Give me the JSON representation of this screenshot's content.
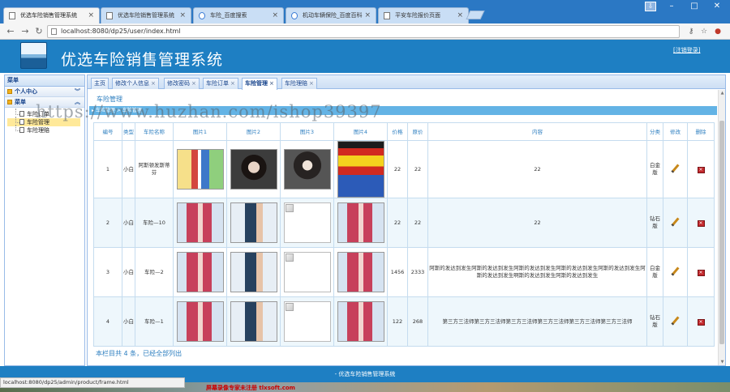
{
  "browser": {
    "tabs": [
      {
        "title": "优选车险销售管理系统"
      },
      {
        "title": "优选车险销售管理系统"
      },
      {
        "title": "车险_百度搜索"
      },
      {
        "title": "机动车辆保险_百度百科"
      },
      {
        "title": "平安车险报价页面"
      }
    ],
    "url": "localhost:8080/dp25/user/index.html",
    "status_url": "localhost:8080/dp25/admin/product/frame.html"
  },
  "app": {
    "title": "优选车险销售管理系统",
    "top_link": "[注销登录]",
    "footer": "- 优选车险销售管理系统"
  },
  "menu": {
    "header": "菜单",
    "sections": [
      {
        "label": "个人中心",
        "items": []
      },
      {
        "label": "菜单",
        "items": [
          {
            "label": "车险订单",
            "selected": false
          },
          {
            "label": "车险管理",
            "selected": true
          },
          {
            "label": "车险理赔",
            "selected": false
          }
        ]
      }
    ]
  },
  "content_tabs": [
    {
      "label": "主页",
      "active": false,
      "closable": false
    },
    {
      "label": "修改个人信息",
      "active": false,
      "closable": true
    },
    {
      "label": "修改密码",
      "active": false,
      "closable": true
    },
    {
      "label": "车险订单",
      "active": false,
      "closable": true
    },
    {
      "label": "车险管理",
      "active": true,
      "closable": true
    },
    {
      "label": "车险理赔",
      "active": false,
      "closable": true
    }
  ],
  "page": {
    "section_title": "车险管理",
    "bar_text": "▸ 车险管理 > 车险管理",
    "summary": "本栏目共 4 条，已经全部列出"
  },
  "table": {
    "headers": [
      "编号",
      "类型",
      "车险名称",
      "图片1",
      "图片2",
      "图片3",
      "图片4",
      "价格",
      "原价",
      "内容",
      "分类",
      "修改",
      "删除"
    ],
    "rows": [
      {
        "id": "1",
        "type": "小白",
        "name": "阿斯顿发斯蒂芬",
        "img1": "cartoon",
        "img2": "dark",
        "img3": "gray",
        "img4": "lego",
        "price": "22",
        "orig": "22",
        "content": "22",
        "category": "白金版"
      },
      {
        "id": "2",
        "type": "小白",
        "name": "车险—10",
        "img1": "anime",
        "img2": "conan",
        "img3": "broken",
        "img4": "anime",
        "price": "22",
        "orig": "22",
        "content": "22",
        "category": "钻石版"
      },
      {
        "id": "3",
        "type": "小白",
        "name": "车险—2",
        "img1": "anime",
        "img2": "conan",
        "img3": "broken",
        "img4": "anime",
        "price": "1456",
        "orig": "2333",
        "content": "阿斯的发达到发生阿斯的发达到发生阿斯的发达到发生阿斯的发达到发生阿斯的发达到发生阿斯的发达到发生啊斯的发达到发生阿斯的发达到发生",
        "category": "白金版"
      },
      {
        "id": "4",
        "type": "小白",
        "name": "车险—1",
        "img1": "anime",
        "img2": "conan",
        "img3": "broken",
        "img4": "anime",
        "price": "122",
        "orig": "268",
        "content": "第三方三法师第三方三法师第三方三法师第三方三法师第三方三法师第三方三法师",
        "category": "钻石版"
      }
    ]
  },
  "watermark": {
    "main": "https://www.huzhan.com/ishop39397",
    "footer": "屏幕录像专家未注册 tlxsoft.com"
  },
  "colors": {
    "header_blue": "#1e7fc3",
    "accent": "#2e7fc0",
    "bar": "#63b3e5"
  }
}
